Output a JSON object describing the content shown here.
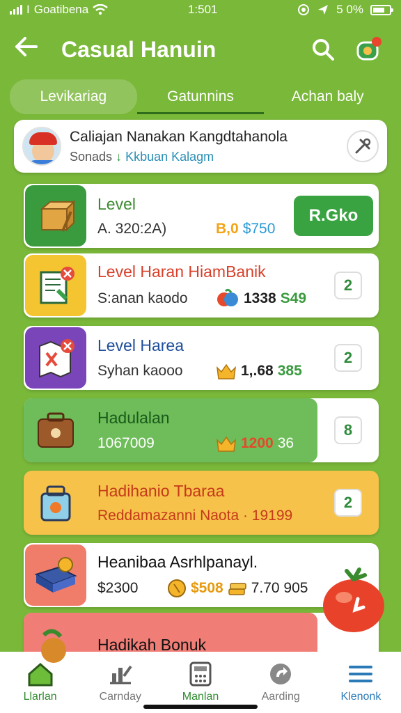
{
  "status_bar": {
    "carrier": "Goatibena",
    "time": "1:501",
    "battery": "5 0%"
  },
  "header": {
    "title": "Casual Hanuin",
    "back_icon": "arrow-left-icon",
    "search_icon": "search-icon",
    "chat_icon": "chat-notification-icon"
  },
  "tabs": [
    {
      "label": "Levikariag"
    },
    {
      "label": "Gatunnins"
    },
    {
      "label": "Achan baly"
    }
  ],
  "profile": {
    "name": "Caliajan Nanakan Kangdtahanola",
    "sub_a": "Sonads",
    "sub_arrow": "↓",
    "sub_b": "Kkbuan Kalagm"
  },
  "levels": [
    {
      "title": "Level",
      "sub": "A. 320:2A)",
      "stat1": "B,0",
      "stat2": "$750",
      "action_label": "R.Gko",
      "accent": "#3fa33f"
    },
    {
      "title": "Level Haran HiamBanik",
      "sub": "S:anan kaodo",
      "stat1": "1338",
      "stat2": "S49",
      "badge": "2",
      "accent": "#f4c431"
    },
    {
      "title": "Level Harea",
      "sub": "Syhan kaooo",
      "stat1": "1,.68",
      "stat2": "385",
      "badge": "2",
      "accent": "#7a45b8"
    },
    {
      "title": "Hadulalan",
      "sub": "1067009",
      "stat1": "1200",
      "stat2": "36",
      "badge": "8",
      "accent": "#6ebd5a"
    },
    {
      "title": "Hadihanio Tbaraa",
      "sub": "Reddamazanni Naota · 19199",
      "badge": "2",
      "accent": "#f6c24a"
    },
    {
      "title": "Heanibaa Asrhlpanayl.",
      "sub": "$2300",
      "stat1": "$508",
      "stat2": "7.70 905",
      "accent": "#f07d6a"
    },
    {
      "title": "Hadikah Bonuk",
      "accent": "#f07d76"
    }
  ],
  "bottom_nav": [
    {
      "label": "Llarlan",
      "icon": "home-icon"
    },
    {
      "label": "Carnday",
      "icon": "chart-icon"
    },
    {
      "label": "Manlan",
      "icon": "calculator-icon"
    },
    {
      "label": "Aarding",
      "icon": "refresh-icon"
    },
    {
      "label": "Klenonk",
      "icon": "menu-icon"
    }
  ]
}
